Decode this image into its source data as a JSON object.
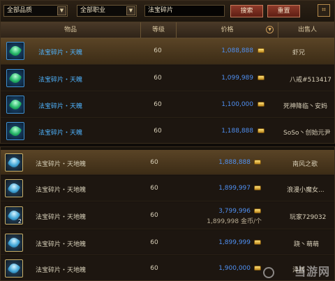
{
  "filter": {
    "quality": "全部品质",
    "profession": "全部职业",
    "search_value": "法宝碎片",
    "search_button": "搜索",
    "reset_button": "重置"
  },
  "table": {
    "headers": {
      "item": "物品",
      "level": "等级",
      "price": "价格",
      "seller": "出售人"
    }
  },
  "list_top": [
    {
      "name": "法宝碎片・天魄",
      "level": "60",
      "price": "1,088,888",
      "seller": "虾兄"
    },
    {
      "name": "法宝碎片・天魄",
      "level": "60",
      "price": "1,099,989",
      "seller": "八戒#513417"
    },
    {
      "name": "法宝碎片・天魄",
      "level": "60",
      "price": "1,100,000",
      "seller": "死神降临丶安妈"
    },
    {
      "name": "法宝碎片・天魄",
      "level": "60",
      "price": "1,188,888",
      "seller": "SoSo丶创始元尹"
    }
  ],
  "list_bottom": [
    {
      "name": "法宝碎片・天地魄",
      "level": "60",
      "price": "1,888,888",
      "seller": "南风之歌"
    },
    {
      "name": "法宝碎片・天地魄",
      "level": "60",
      "price": "1,899,997",
      "seller": "浪漫小魔女..."
    },
    {
      "name": "法宝碎片・天地魄",
      "level": "60",
      "price": "3,799,996",
      "unit_price": "1,899,998 金币/个",
      "stack": "2",
      "seller": "玩家729032"
    },
    {
      "name": "法宝碎片・天地魄",
      "level": "60",
      "price": "1,899,999",
      "seller": "跷丶萌萌"
    },
    {
      "name": "法宝碎片・天地魄",
      "level": "60",
      "price": "1,900,000",
      "seller": "泽西"
    }
  ],
  "watermark": "当游网",
  "colors": {
    "accent_blue": "#4f8ff0",
    "name_blue": "#4fb4ff",
    "button_red": "#8e3a2a",
    "highlight_row": "#5a4426"
  },
  "icons": {
    "gear": "settings-icon",
    "dropdown": "chevron-down-icon",
    "coin": "gold-coin-icon",
    "gem": "jade-gem-icon"
  }
}
